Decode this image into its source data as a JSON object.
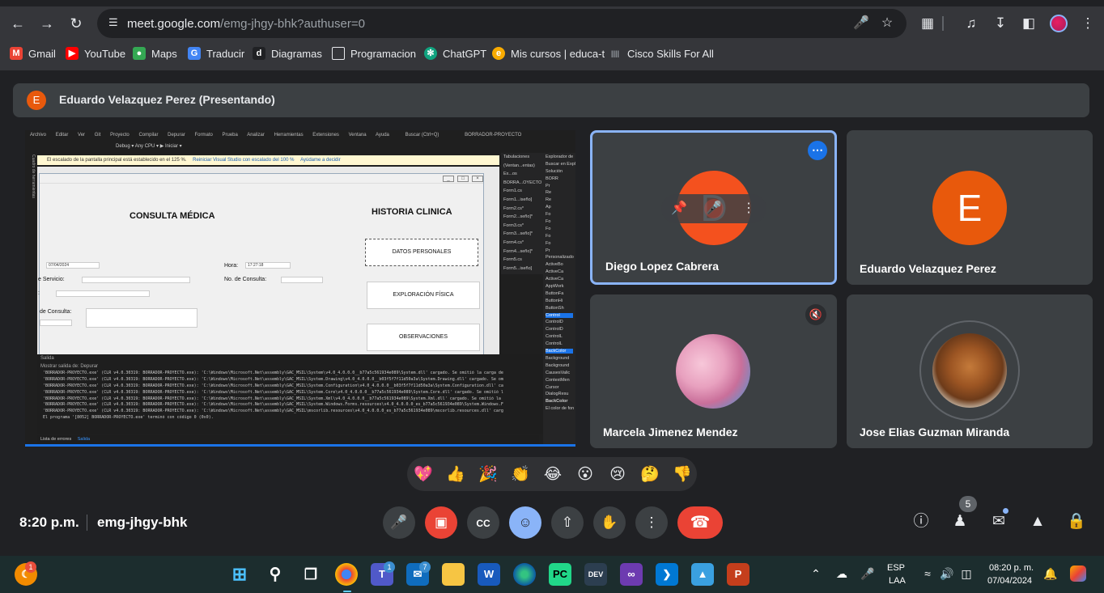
{
  "browser": {
    "url_host": "meet.google.com",
    "url_path": "/emg-jhgy-bhk?authuser=0",
    "bookmarks": [
      {
        "label": "Gmail",
        "icon": "gmail-icon",
        "color": "#ea4335"
      },
      {
        "label": "YouTube",
        "icon": "youtube-icon",
        "color": "#ff0000"
      },
      {
        "label": "Maps",
        "icon": "maps-icon",
        "color": "#34a853"
      },
      {
        "label": "Traducir",
        "icon": "translate-icon",
        "color": "#4285f4"
      },
      {
        "label": "Diagramas",
        "icon": "diagrams-icon",
        "color": "#202124"
      },
      {
        "label": "Programacion",
        "icon": "folder-icon",
        "color": "#35363a"
      },
      {
        "label": "ChatGPT",
        "icon": "chatgpt-icon",
        "color": "#10a37f"
      },
      {
        "label": "Mis cursos | educa-t",
        "icon": "educat-icon",
        "color": "#f9ab00"
      },
      {
        "label": "Cisco Skills For All",
        "icon": "cisco-icon",
        "color": "#35363a"
      }
    ]
  },
  "meet": {
    "presenter_label": "Eduardo Velazquez Perez (Presentando)",
    "presenter_initial": "E",
    "accent": "#1a73e8",
    "participants": [
      {
        "name": "Diego Lopez Cabrera",
        "initial": "D",
        "avatar_color": "#f4511e"
      },
      {
        "name": "Eduardo Velazquez Perez",
        "initial": "E",
        "avatar_color": "#e8590c"
      },
      {
        "name": "Marcela Jimenez Mendez"
      },
      {
        "name": "Jose Elias Guzman Miranda"
      }
    ],
    "reactions": [
      "💖",
      "👍",
      "🎉",
      "👏",
      "😂",
      "😮",
      "😢",
      "🤔",
      "👎"
    ],
    "clock": "8:20 p.m.",
    "meeting_code": "emg-jhgy-bhk",
    "participant_count": "5"
  },
  "shared_screen": {
    "menu": [
      "Archivo",
      "Editar",
      "Ver",
      "Git",
      "Proyecto",
      "Compilar",
      "Depurar",
      "Formato",
      "Prueba",
      "Analizar",
      "Herramientas",
      "Extensiones",
      "Ventana",
      "Ayuda",
      "Buscar (Ctrl+Q)",
      "BORRADOR-PROYECTO"
    ],
    "toolbar": "Debug   ▾   Any CPU   ▾   ▶ Iniciar  ▾",
    "info_bar": "El escalado de la pantalla principal está establecido en el 125 %.",
    "info_link1": "Reiniciar Visual Studio con escalado del 100 %",
    "info_link2": "Ayúdame a decidir",
    "side_label": "Cuadro de herramientas",
    "form": {
      "title_left": "CONSULTA MÉDICA",
      "title_right": "HISTORIA CLINICA",
      "date_value": "07/04/2024",
      "time_label": "Hora:",
      "time_value": "17:27:18",
      "service_label": "e Servicio:",
      "consult_no_label": "No. de Consulta:",
      "colon_label": ":",
      "consult_label": "de Consulta:",
      "btn_personal": "DATOS PERSONALES",
      "btn_exploration": "EXPLORACIÓN FÍSICA",
      "btn_observations": "OBSERVACIONES"
    },
    "tabs_panel": [
      "Tabulaciones",
      "(Ventan...entas)",
      "Ex...os",
      "BORRA...OYECTO",
      "Form1.cs",
      "Form1...iseño]",
      "Form2.cs*",
      "Form2...seño]*",
      "Form3.cs*",
      "Form3...seño]*",
      "Form4.cs*",
      "Form4...seño]*",
      "Form5.cs",
      "Form5...iseño]"
    ],
    "explorer_panel": [
      "Explorador de",
      "Buscar en Expl",
      "Solución",
      "BORR",
      "Pr",
      "Re",
      "Re",
      "Ap",
      "Fo",
      "Fo",
      "Fo",
      "Fo",
      "Fo",
      "Pr",
      "Personalizado",
      "ActiveBo",
      "ActiveCa",
      "ActiveCa",
      "AppWork",
      "ButtonFa",
      "ButtonHi",
      "ButtonSh",
      "Control",
      "ControlD",
      "ControlD",
      "ControlL",
      "ControlL",
      "BackColor",
      "Background",
      "Background",
      "CausesValic",
      "ContextMen",
      "Cursor",
      "DialogResu",
      "BackColor",
      "El color de fon"
    ],
    "output_head": "Salida",
    "output_source": "Mostrar salida de:  Depurar",
    "output_lines": [
      "'BORRADOR-PROYECTO.exe' (CLR v4.0.30319: BORRADOR-PROYECTO.exe): 'C:\\Windows\\Microsoft.Net\\assembly\\GAC_MSIL\\System\\v4.0_4.0.0.0__b77a5c561934e089\\System.dll' cargado. Se omitió la carga de",
      "'BORRADOR-PROYECTO.exe' (CLR v4.0.30319: BORRADOR-PROYECTO.exe): 'C:\\Windows\\Microsoft.Net\\assembly\\GAC_MSIL\\System.Drawing\\v4.0_4.0.0.0__b03f5f7f11d50a3a\\System.Drawing.dll' cargado. Se om",
      "'BORRADOR-PROYECTO.exe' (CLR v4.0.30319: BORRADOR-PROYECTO.exe): 'C:\\Windows\\Microsoft.Net\\assembly\\GAC_MSIL\\System.Configuration\\v4.0_4.0.0.0__b03f5f7f11d50a3a\\System.Configuration.dll' ca",
      "'BORRADOR-PROYECTO.exe' (CLR v4.0.30319: BORRADOR-PROYECTO.exe): 'C:\\Windows\\Microsoft.Net\\assembly\\GAC_MSIL\\System.Core\\v4.0_4.0.0.0__b77a5c561934e089\\System.Core.dll' cargado. Se omitió l",
      "'BORRADOR-PROYECTO.exe' (CLR v4.0.30319: BORRADOR-PROYECTO.exe): 'C:\\Windows\\Microsoft.Net\\assembly\\GAC_MSIL\\System.Xml\\v4.0_4.0.0.0__b77a5c561934e089\\System.Xml.dll' cargado. Se omitió la",
      "'BORRADOR-PROYECTO.exe' (CLR v4.0.30319: BORRADOR-PROYECTO.exe): 'C:\\Windows\\Microsoft.Net\\assembly\\GAC_MSIL\\System.Windows.Forms.resources\\v4.0_4.0.0.0_es_b77a5c561934e089\\System.Windows.F",
      "'BORRADOR-PROYECTO.exe' (CLR v4.0.30319: BORRADOR-PROYECTO.exe): 'C:\\Windows\\Microsoft.Net\\assembly\\GAC_MSIL\\mscorlib.resources\\v4.0_4.0.0.0_es_b77a5c561934e089\\mscorlib.resources.dll' carg",
      "El programa '[8052] BORRADOR-PROYECTO.exe' terminó con código 0 (0x0)."
    ],
    "status_errors": "Lista de errores",
    "status_output": "Salida"
  },
  "taskbar": {
    "weather_badge": "1",
    "teams_badge": "1",
    "outlook_badge": "7",
    "lang": "ESP",
    "region": "LAA",
    "time": "08:20 p. m.",
    "date": "07/04/2024"
  }
}
